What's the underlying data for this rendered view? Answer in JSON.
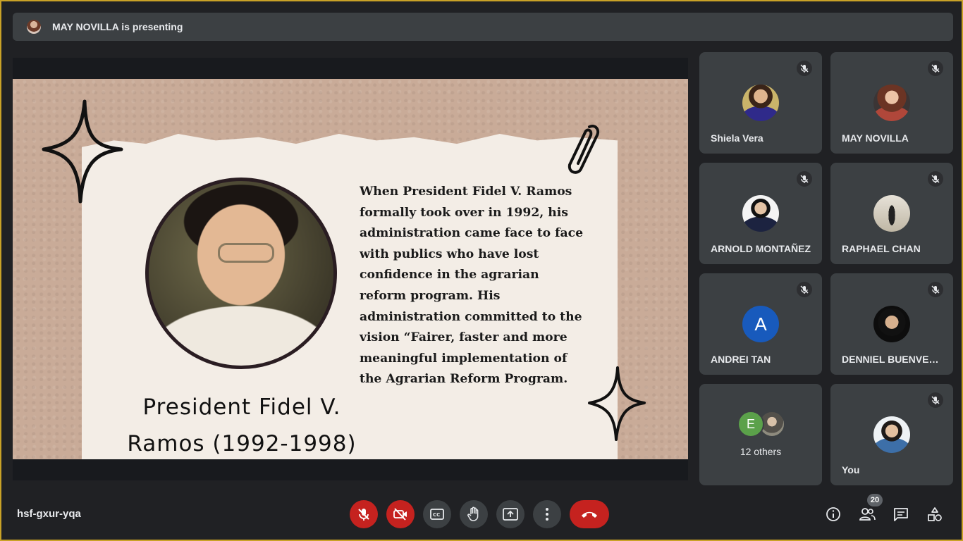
{
  "presenting_banner": {
    "text": "MAY NOVILLA is presenting"
  },
  "slide": {
    "title": "President Fidel V. Ramos (1992-1998)",
    "body": "When President Fidel V. Ramos formally took over in 1992, his administration came face to face with publics who have lost confidence in the agrarian reform program. His administration committed to the vision “Fairer, faster and more meaningful implementation of the Agrarian Reform Program."
  },
  "participants": [
    {
      "name": "Shiela Vera",
      "muted": true
    },
    {
      "name": "MAY NOVILLA",
      "muted": true
    },
    {
      "name": "ARNOLD MONTAÑEZ",
      "muted": true
    },
    {
      "name": "RAPHAEL CHAN",
      "muted": true
    },
    {
      "name": "ANDREI TAN",
      "initial": "A",
      "muted": true
    },
    {
      "name": "DENNIEL BUENVENIDA",
      "muted": true
    },
    {
      "others_label": "12 others",
      "initial": "E"
    },
    {
      "name": "You",
      "muted": true
    }
  ],
  "bottom_bar": {
    "meeting_code": "hsf-gxur-yqa",
    "participant_count": "20"
  },
  "colors": {
    "background": "#202124",
    "tile": "#3c4043",
    "danger": "#c5221f",
    "andrei_avatar": "#185abc"
  },
  "icons": [
    "mic-off-icon",
    "camera-off-icon",
    "captions-icon",
    "raise-hand-icon",
    "present-icon",
    "more-options-icon",
    "hang-up-icon",
    "info-icon",
    "people-icon",
    "chat-icon",
    "activities-icon"
  ]
}
